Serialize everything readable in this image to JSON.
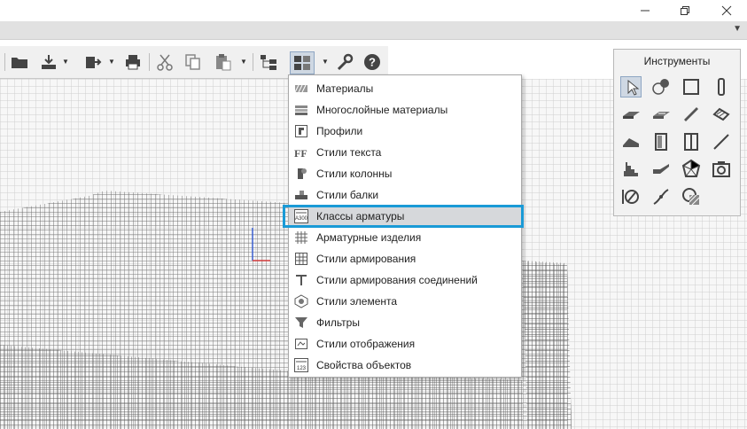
{
  "window": {
    "minimize_icon": "minimize-icon",
    "restore_icon": "restore-icon",
    "close_icon": "close-icon"
  },
  "tabstrip": {
    "arrow_icon": "triangle-down-icon"
  },
  "toolbar": {
    "buttons": [
      "open-folder-icon",
      "import-icon",
      "export-icon",
      "print-icon",
      "cut-icon",
      "copy-icon",
      "paste-icon",
      "organizer-icon",
      "libraries-icon",
      "settings-wrench-icon",
      "help-icon"
    ]
  },
  "menu": {
    "items": [
      {
        "label": "Материалы",
        "icon": "materials-icon"
      },
      {
        "label": "Многослойные материалы",
        "icon": "multilayer-materials-icon"
      },
      {
        "label": "Профили",
        "icon": "profiles-icon"
      },
      {
        "label": "Стили текста",
        "icon": "text-styles-icon"
      },
      {
        "label": "Стили колонны",
        "icon": "column-styles-icon"
      },
      {
        "label": "Стили балки",
        "icon": "beam-styles-icon"
      },
      {
        "label": "Классы арматуры",
        "icon": "rebar-classes-icon",
        "sublabel": "A300"
      },
      {
        "label": "Арматурные изделия",
        "icon": "rebar-products-icon"
      },
      {
        "label": "Стили армирования",
        "icon": "reinforcement-styles-icon"
      },
      {
        "label": "Стили армирования соединений",
        "icon": "joint-reinforcement-styles-icon"
      },
      {
        "label": "Стили элемента",
        "icon": "element-styles-icon"
      },
      {
        "label": "Фильтры",
        "icon": "filters-icon"
      },
      {
        "label": "Стили отображения",
        "icon": "display-styles-icon"
      },
      {
        "label": "Свойства объектов",
        "icon": "object-properties-icon",
        "sublabel": "123"
      }
    ],
    "highlighted_index": 6,
    "highlight_color": "#1a9ad6"
  },
  "tools_panel": {
    "title": "Инструменты",
    "tools": [
      "select-arrow-icon",
      "dimension-shapes-icon",
      "wall-icon",
      "column-icon",
      "slab-icon",
      "floor-icon",
      "beam-icon",
      "rebar-icon",
      "roof-icon",
      "door-icon",
      "window-icon",
      "line-icon",
      "stair-icon",
      "ramp-icon",
      "polyhedron-icon",
      "camera-icon",
      "section-icon",
      "curve-icon",
      "hatch-icon"
    ]
  },
  "colors": {
    "toolbar_bg": "#f0f0f0",
    "accent": "#1a9ad6",
    "active_button": "#cfd8e3"
  }
}
